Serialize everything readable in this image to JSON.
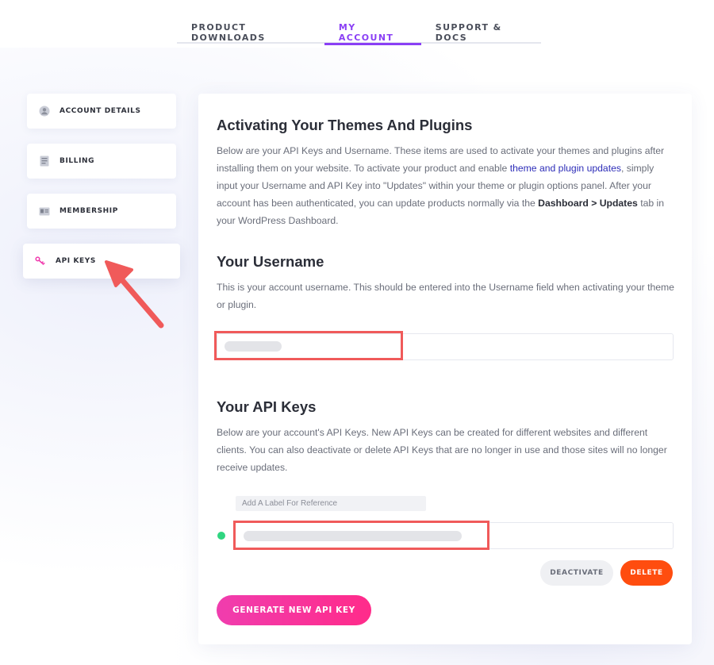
{
  "tabs": [
    {
      "label": "PRODUCT DOWNLOADS",
      "active": false
    },
    {
      "label": "MY ACCOUNT",
      "active": true
    },
    {
      "label": "SUPPORT & DOCS",
      "active": false
    }
  ],
  "sidebar": {
    "items": [
      {
        "label": "ACCOUNT DETAILS",
        "icon": "user-icon",
        "active": false
      },
      {
        "label": "BILLING",
        "icon": "document-icon",
        "active": false
      },
      {
        "label": "MEMBERSHIP",
        "icon": "id-card-icon",
        "active": false
      },
      {
        "label": "API KEYS",
        "icon": "key-icon",
        "active": true
      }
    ]
  },
  "main": {
    "activating": {
      "title": "Activating Your Themes And Plugins",
      "text_1": "Below are your API Keys and Username. These items are used to activate your themes and plugins after installing them on your website. To activate your product and enable ",
      "link": "theme and plugin updates",
      "text_2": ", simply input your Username and API Key into \"Updates\" within your theme or plugin options panel. After your account has been authenticated, you can update products normally via the ",
      "bold": "Dashboard > Updates",
      "text_3": " tab in your WordPress Dashboard."
    },
    "username": {
      "title": "Your Username",
      "description": "This is your account username. This should be entered into the Username field when activating your theme or plugin."
    },
    "api_keys": {
      "title": "Your API Keys",
      "description": "Below are your account's API Keys. New API Keys can be created for different websites and different clients. You can also deactivate or delete API Keys that are no longer in use and those sites will no longer receive updates.",
      "label_placeholder": "Add A Label For Reference",
      "deactivate_label": "DEACTIVATE",
      "delete_label": "DELETE",
      "generate_label": "GENERATE NEW API KEY"
    }
  },
  "colors": {
    "accent": "#8a3ff5",
    "highlight": "#f05a5a",
    "delete": "#ff4d0f",
    "generate": "#f03dae",
    "status_active": "#2fd580"
  }
}
